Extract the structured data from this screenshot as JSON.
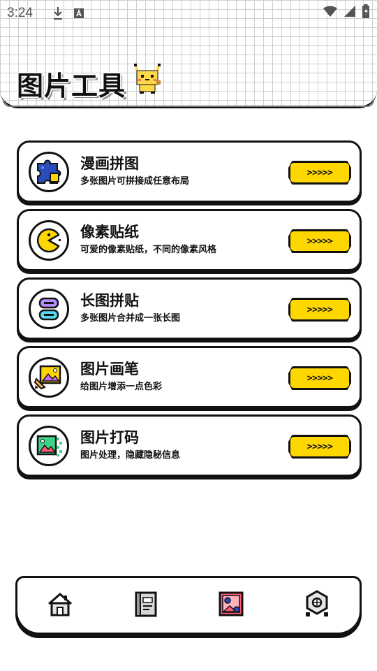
{
  "status_bar": {
    "time": "3:24",
    "icons": [
      "download-icon",
      "a-icon",
      "wifi-icon",
      "signal-icon",
      "battery-icon"
    ]
  },
  "header": {
    "title": "图片工具",
    "mascot": "pixel-pikachu-icon"
  },
  "tools": [
    {
      "title": "漫画拼图",
      "subtitle": "多张图片可拼接成任意布局",
      "icon": "puzzle-icon",
      "button": ">>>>>"
    },
    {
      "title": "像素贴纸",
      "subtitle": "可爱的像素贴纸，不同的像素风格",
      "icon": "pacman-icon",
      "button": ">>>>>"
    },
    {
      "title": "长图拼贴",
      "subtitle": "多张图片合并成一张长图",
      "icon": "stacked-blocks-icon",
      "button": ">>>>>"
    },
    {
      "title": "图片画笔",
      "subtitle": "给图片增添一点色彩",
      "icon": "picture-pencil-icon",
      "button": ">>>>>"
    },
    {
      "title": "图片打码",
      "subtitle": "图片处理，隐藏隐秘信息",
      "icon": "pixelated-picture-icon",
      "button": ">>>>>"
    }
  ],
  "bottom_nav": {
    "items": [
      "home-icon",
      "book-icon",
      "image-icon",
      "settings-icon"
    ]
  },
  "colors": {
    "accent": "#ffd700",
    "outline": "#111111"
  }
}
